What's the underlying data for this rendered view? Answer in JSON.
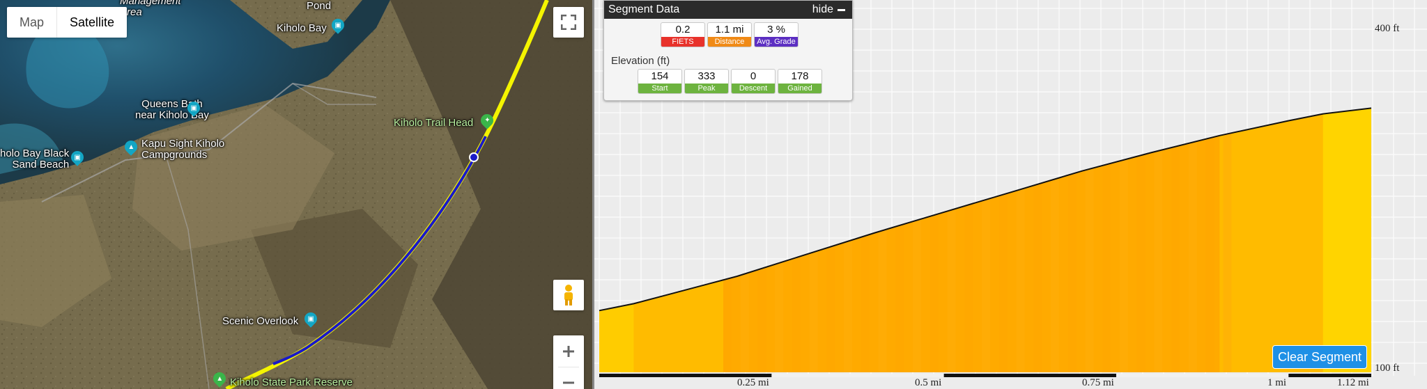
{
  "map": {
    "type_buttons": {
      "map": "Map",
      "satellite": "Satellite"
    },
    "labels": {
      "management_area": "Management\nArea",
      "pond": "Pond",
      "kiholo_bay": "Kiholo Bay",
      "queens_bath": "Queens Bath\nnear Kiholo Bay",
      "kapu_sight": "Kapu Sight Kiholo\nCampgrounds",
      "black_sand": "holo Bay Black\nSand Beach",
      "trail_head": "Kiholo Trail Head",
      "scenic_overlook": "Scenic Overlook",
      "state_park": "Kiholo State Park Reserve"
    },
    "icons": {
      "fullscreen": "fullscreen-icon",
      "pegman": "pegman-icon",
      "zoom_in": "zoom-in-icon",
      "zoom_out": "zoom-out-icon"
    }
  },
  "segment": {
    "title": "Segment Data",
    "hide_label": "hide",
    "metrics": [
      {
        "value": "0.2",
        "label": "FIETS",
        "color": "#e8322b"
      },
      {
        "value": "1.1 mi",
        "label": "Distance",
        "color": "#f08a16"
      },
      {
        "value": "3 %",
        "label": "Avg. Grade",
        "color": "#5c2fc2"
      }
    ],
    "elevation_title": "Elevation (ft)",
    "elevation": [
      {
        "value": "154",
        "label": "Start"
      },
      {
        "value": "333",
        "label": "Peak"
      },
      {
        "value": "0",
        "label": "Descent"
      },
      {
        "value": "178",
        "label": "Gained"
      }
    ],
    "elevation_color": "#6db33f"
  },
  "chart": {
    "y_top": "400 ft",
    "y_bottom": "100 ft",
    "x_ticks": [
      "0.25 mi",
      "0.5 mi",
      "0.75 mi",
      "1 mi",
      "1.12 mi"
    ],
    "clear_button": "Clear Segment",
    "fill_colors": [
      "#ffcc00",
      "#ffbb00",
      "#ffaa00",
      "#ffd400"
    ]
  },
  "chart_data": {
    "type": "area",
    "x": [
      0,
      0.05,
      0.1,
      0.2,
      0.3,
      0.4,
      0.5,
      0.6,
      0.7,
      0.8,
      0.9,
      1.0,
      1.05,
      1.12
    ],
    "y": [
      154,
      160,
      168,
      184,
      203,
      222,
      240,
      258,
      276,
      292,
      307,
      320,
      326,
      331
    ],
    "ylim": [
      100,
      400
    ]
  }
}
